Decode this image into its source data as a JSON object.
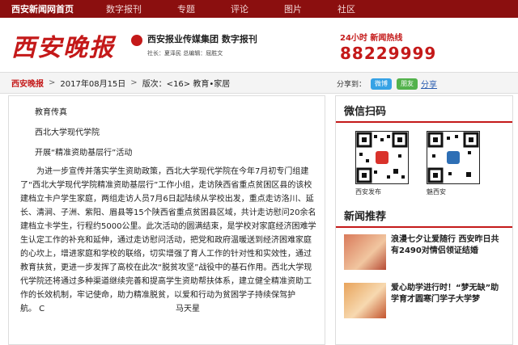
{
  "topnav": [
    "西安新闻网首页",
    "数字报刊",
    "专题",
    "评论",
    "图片",
    "社区"
  ],
  "masthead": {
    "logo_text": "西安晚报",
    "group": "西安报业传媒集团 数字报刊",
    "staff": "社长：夏泽民    总编辑：屈胜文",
    "hotline_title": "24小时  新闻热线",
    "hotline_number": "88229999"
  },
  "breadcrumb": {
    "home": "西安晚报",
    "date": "2017年08月15日",
    "edition": "版次：<16> 教育•家居"
  },
  "share": {
    "label": "分享到：",
    "weibo": "微博",
    "wechat": "朋友",
    "link": "分享"
  },
  "article": {
    "lines": [
      "教育传真",
      "西北大学现代学院",
      "开展“精准资助基层行”活动"
    ],
    "body": "为进一步宣传并落实学生资助政策，西北大学现代学院在今年7月初专门组建了“西北大学现代学院精准资助基层行”工作小组，走访陕西省重点贫困区县的该校建档立卡户学生家庭，两组走访人员7月6日起陆续从学校出发，重点走访洛川、延长、清涧、子洲、紫阳、眉县等15个陕西省重点贫困县区域，共计走访慰问20余名建档立卡学生，行程约5000公里。此次活动的圆满结束，是学校对家庭经济困难学生认定工作的补充和延伸，通过走访慰问活动，把党和政府温暖送到经济困难家庭的心坎上，增进家庭和学校的联络，切实增强了育人工作的针对性和实效性，通过教育扶贫，更进一步发挥了高校在此次“脱贫攻坚”战役中的基石作用。西北大学现代学院还将通过多种渠道继续完善和提高学生资助帮扶体系，建立健全精准资助工作的长效机制，牢记使命，助力精准脱贫，以爱和行动为贫困学子持续保驾护",
    "last_left": "航。  C",
    "last_right": "马天星"
  },
  "sidebar": {
    "qr_title": "微信扫码",
    "qr_items": [
      "西安发布",
      "魅西安"
    ],
    "news_title": "新闻推荐",
    "news": [
      "浪漫七夕让爱随行 西安昨日共有2490对情侣领证结婚",
      "爱心助学进行时！“梦无缺”助学育才圆寒门学子大学梦"
    ]
  },
  "colors": {
    "brand_red": "#c41919",
    "nav_bg": "#8b0f0f"
  }
}
